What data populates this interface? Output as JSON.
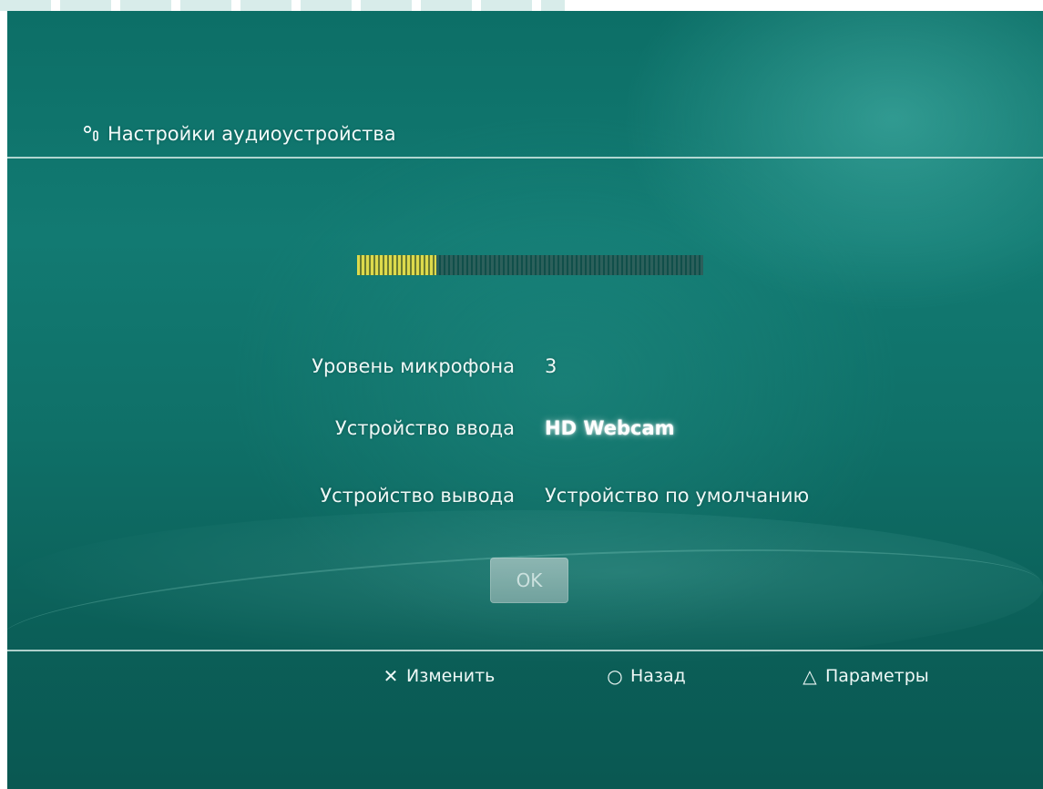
{
  "header": {
    "title": "Настройки аудиоустройства",
    "icon": "microphone-icon"
  },
  "mic_meter": {
    "level_fraction": 0.23
  },
  "settings": [
    {
      "label": "Уровень микрофона",
      "value": "3"
    },
    {
      "label": "Устройство ввода",
      "value": "HD Webcam"
    },
    {
      "label": "Устройство вывода",
      "value": "Устройство по умолчанию"
    }
  ],
  "ok_button": {
    "label": "OK"
  },
  "footer": {
    "change_label": "Изменить",
    "change_glyph": "✕",
    "back_label": "Назад",
    "back_glyph": "○",
    "options_label": "Параметры",
    "options_glyph": "△"
  },
  "colors": {
    "background": "#0f7068",
    "meter_active": "#e8e04a",
    "meter_inactive": "#2f5c58"
  }
}
